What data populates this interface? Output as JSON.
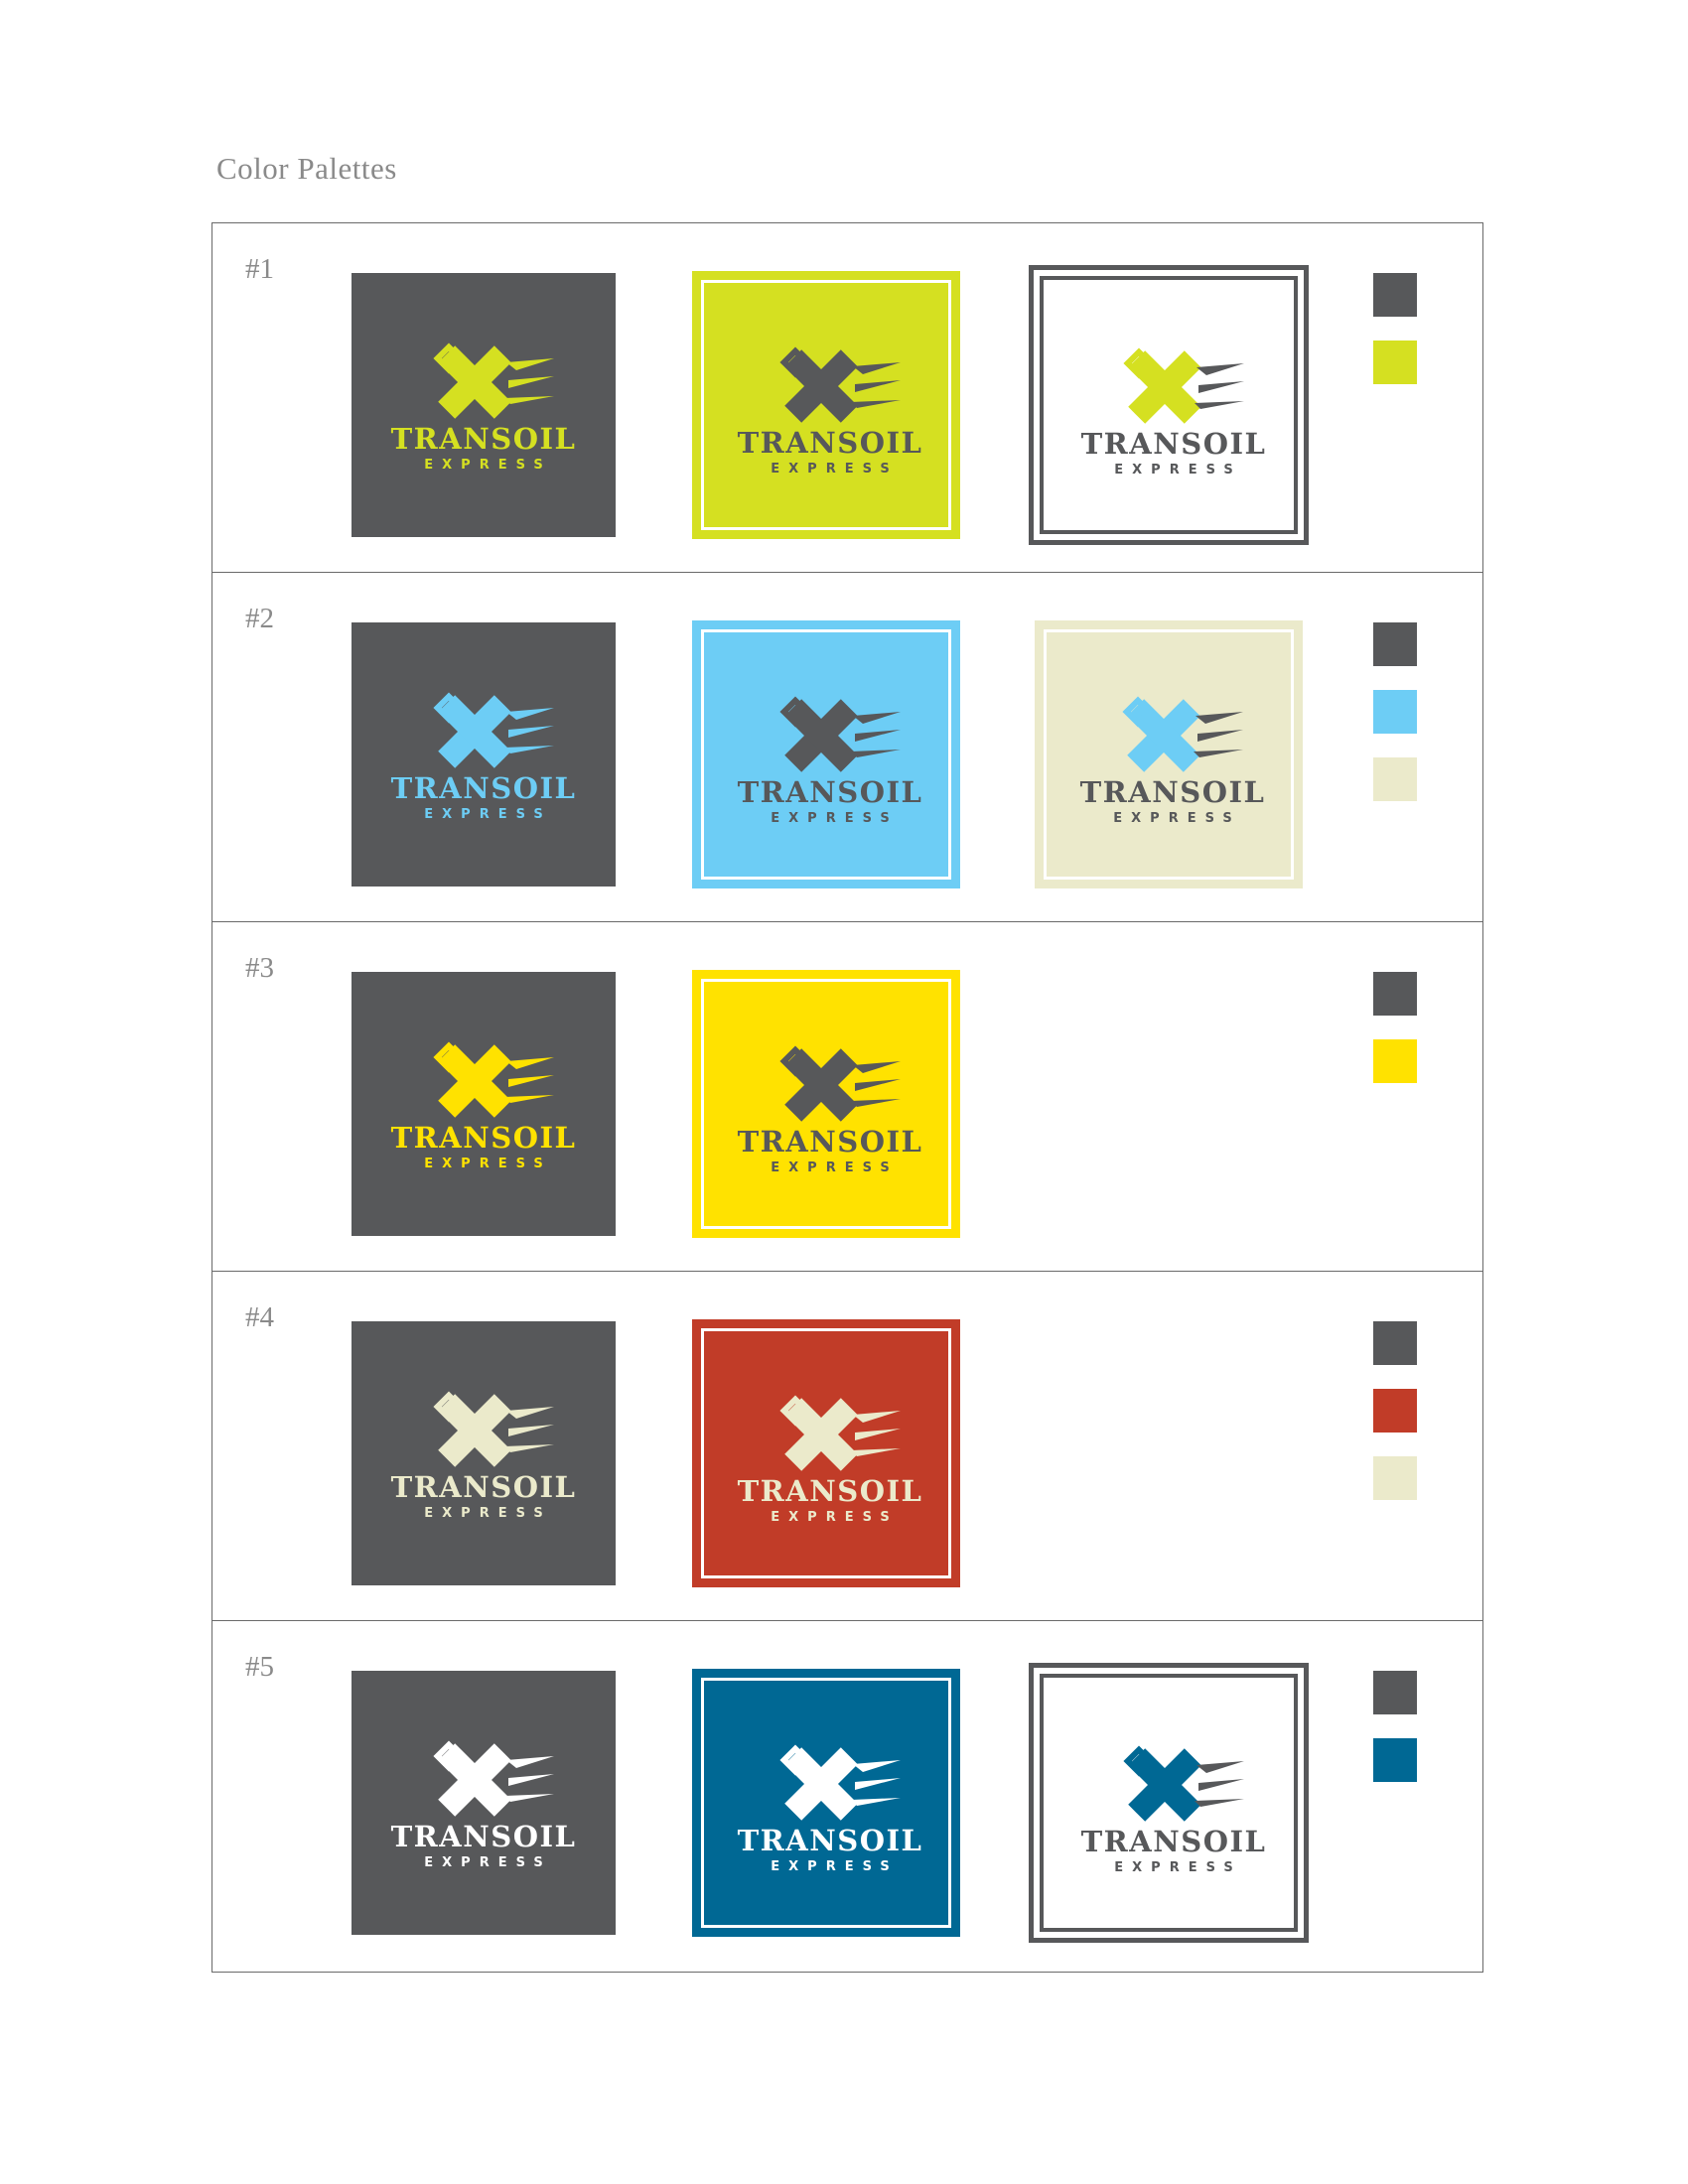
{
  "title": "Color Palettes",
  "logo": {
    "name": "TRANSOIL",
    "tagline": "EXPRESS",
    "mark": "x-fuel-can-icon"
  },
  "colors": {
    "charcoal": "#57585a",
    "lime": "#d5e021",
    "sky": "#6dcdf5",
    "cream": "#ebeacb",
    "yellow": "#ffe200",
    "brick": "#c13c28",
    "ocean": "#006894",
    "white": "#ffffff"
  },
  "palettes": [
    {
      "number": "#1",
      "tiles": [
        {
          "style": "plain",
          "bg": "#57585a",
          "mark": "#d5e021",
          "text": "#d5e021",
          "speed": "#d5e021"
        },
        {
          "style": "framed",
          "bg": "#d5e021",
          "frame": "#d5e021",
          "mark": "#57585a",
          "text": "#57585a",
          "speed": "#57585a"
        },
        {
          "style": "outline",
          "bg": "#ffffff",
          "frame": "#57585a",
          "mark": "#d5e021",
          "text": "#57585a",
          "speed": "#57585a"
        }
      ],
      "swatches": [
        "#57585a",
        "#d5e021"
      ]
    },
    {
      "number": "#2",
      "tiles": [
        {
          "style": "plain",
          "bg": "#57585a",
          "mark": "#6dcdf5",
          "text": "#6dcdf5",
          "speed": "#6dcdf5"
        },
        {
          "style": "framed",
          "bg": "#6dcdf5",
          "frame": "#6dcdf5",
          "mark": "#57585a",
          "text": "#57585a",
          "speed": "#57585a"
        },
        {
          "style": "framed",
          "bg": "#ebeacb",
          "frame": "#ebeacb",
          "mark": "#6dcdf5",
          "text": "#57585a",
          "speed": "#57585a"
        }
      ],
      "swatches": [
        "#57585a",
        "#6dcdf5",
        "#ebeacb"
      ]
    },
    {
      "number": "#3",
      "tiles": [
        {
          "style": "plain",
          "bg": "#57585a",
          "mark": "#ffe200",
          "text": "#ffe200",
          "speed": "#ffe200"
        },
        {
          "style": "framed",
          "bg": "#ffe200",
          "frame": "#ffe200",
          "mark": "#57585a",
          "text": "#57585a",
          "speed": "#57585a"
        }
      ],
      "swatches": [
        "#57585a",
        "#ffe200"
      ]
    },
    {
      "number": "#4",
      "tiles": [
        {
          "style": "plain",
          "bg": "#57585a",
          "mark": "#ebeacb",
          "text": "#ebeacb",
          "speed": "#ebeacb"
        },
        {
          "style": "framed",
          "bg": "#c13c28",
          "frame": "#c13c28",
          "mark": "#ebeacb",
          "text": "#ebeacb",
          "speed": "#ebeacb"
        }
      ],
      "swatches": [
        "#57585a",
        "#c13c28",
        "#ebeacb"
      ]
    },
    {
      "number": "#5",
      "tiles": [
        {
          "style": "plain",
          "bg": "#57585a",
          "mark": "#ffffff",
          "text": "#ffffff",
          "speed": "#ffffff"
        },
        {
          "style": "framed",
          "bg": "#006894",
          "frame": "#006894",
          "mark": "#ffffff",
          "text": "#ffffff",
          "speed": "#ffffff"
        },
        {
          "style": "outline",
          "bg": "#ffffff",
          "frame": "#57585a",
          "mark": "#006894",
          "text": "#57585a",
          "speed": "#57585a"
        }
      ],
      "swatches": [
        "#57585a",
        "#006894"
      ]
    }
  ]
}
